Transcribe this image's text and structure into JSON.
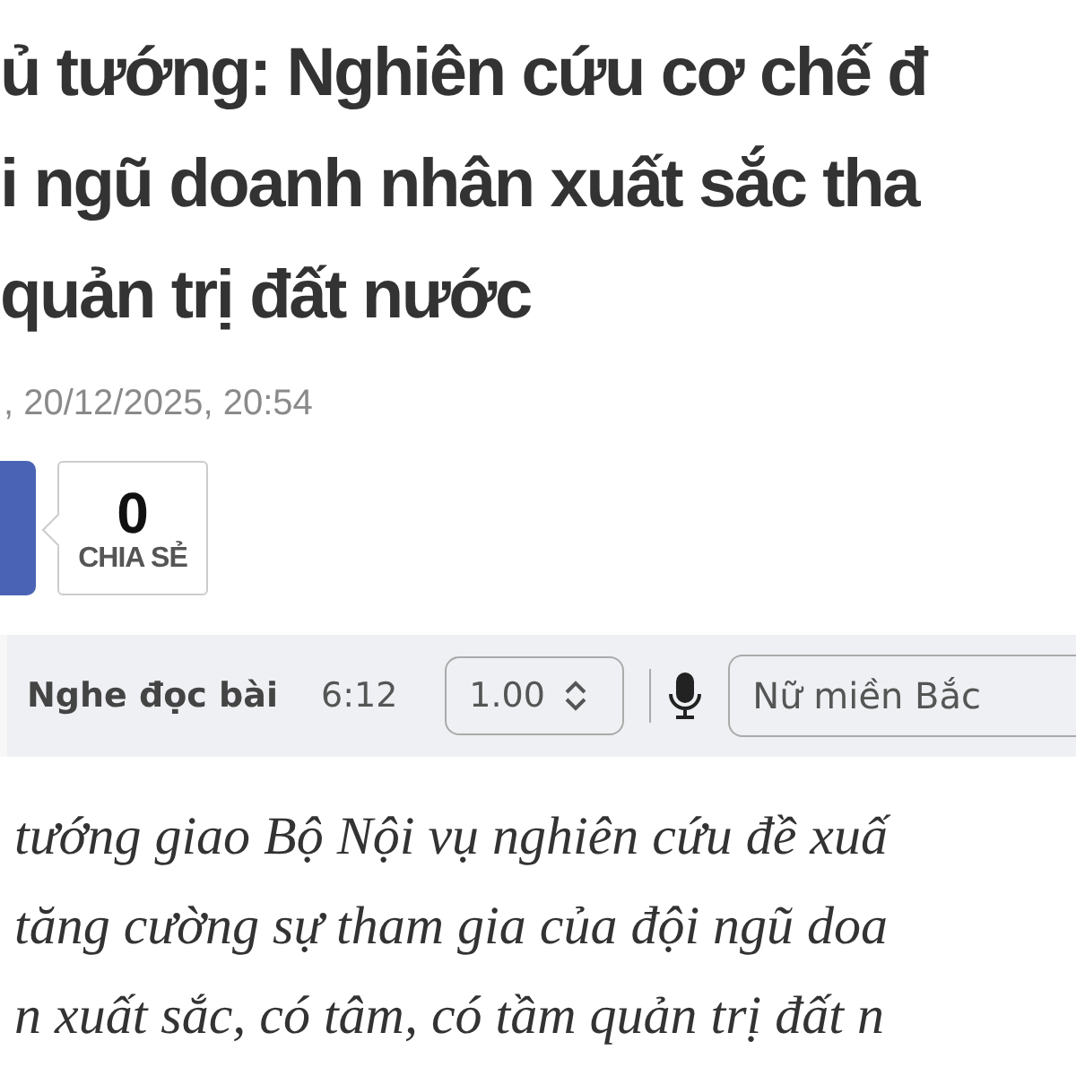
{
  "headline": {
    "lines": [
      "ủ tướng: Nghiên cứu cơ chế đ",
      "i ngũ doanh nhân xuất sắc tha",
      "quản trị đất nước"
    ]
  },
  "meta": {
    "date": ", 20/12/2025, 20:54"
  },
  "share": {
    "count": "0",
    "label": "CHIA SẺ"
  },
  "audio": {
    "label": "Nghe đọc bài",
    "duration": "6:12",
    "speed": "1.00",
    "voice": "Nữ miền Bắc"
  },
  "body": {
    "lines": [
      "tướng giao Bộ Nội vụ nghiên cứu đề xuấ",
      "tăng cường sự tham gia của đội ngũ doa",
      "n xuất sắc, có tâm, có tầm quản trị đất n"
    ]
  }
}
